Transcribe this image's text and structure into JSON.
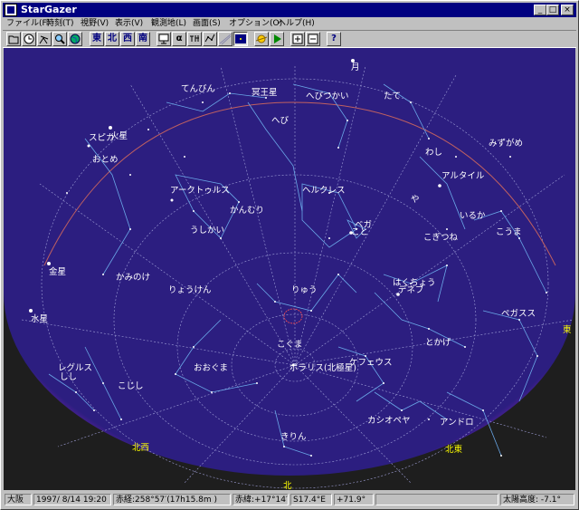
{
  "window": {
    "title": "StarGazer"
  },
  "menu": [
    {
      "label": "ファイル(F)"
    },
    {
      "label": "時刻(T)"
    },
    {
      "label": "視野(V)"
    },
    {
      "label": "表示(V)"
    },
    {
      "label": "観測地(L)"
    },
    {
      "label": "画面(S)"
    },
    {
      "label": "オプション(O)"
    },
    {
      "label": "ヘルプ(H)"
    }
  ],
  "toolbar": {
    "east_label": "東",
    "north_label": "北",
    "west_label": "西",
    "south_label": "南",
    "alpha_label": "α",
    "help_label": "?"
  },
  "colors": {
    "sky": "#2c1e80",
    "ground": "#1e1e1e",
    "horizon_glow": "#c828c8",
    "planet_label": "#ffff00"
  },
  "sky": {
    "constellations": [
      {
        "name": "てんびん"
      },
      {
        "name": "へびつかい"
      },
      {
        "name": "たて"
      },
      {
        "name": "へび"
      },
      {
        "name": "スピカ"
      },
      {
        "name": "わし"
      },
      {
        "name": "みずがめ"
      },
      {
        "name": "おとめ"
      },
      {
        "name": "アルタイル"
      },
      {
        "name": "アークトゥルス"
      },
      {
        "name": "ヘルクレス"
      },
      {
        "name": "や"
      },
      {
        "name": "いるか"
      },
      {
        "name": "かんむり"
      },
      {
        "name": "ベガ"
      },
      {
        "name": "こと"
      },
      {
        "name": "うしかい"
      },
      {
        "name": "こぎつね"
      },
      {
        "name": "こうま"
      },
      {
        "name": "かみのけ"
      },
      {
        "name": "りょうけん"
      },
      {
        "name": "りゅう"
      },
      {
        "name": "はくちょう"
      },
      {
        "name": "デネブ"
      },
      {
        "name": "ペガスス"
      },
      {
        "name": "こぐま"
      },
      {
        "name": "とかげ"
      },
      {
        "name": "おおぐま"
      },
      {
        "name": "ポラリス(北極星)"
      },
      {
        "name": "ケフェウス"
      },
      {
        "name": "こじし"
      },
      {
        "name": "レグルス"
      },
      {
        "name": "しし"
      },
      {
        "name": "カシオペヤ"
      },
      {
        "name": "アンドロ"
      },
      {
        "name": "きりん"
      }
    ],
    "planets": [
      {
        "name": "月"
      },
      {
        "name": "冥王星"
      },
      {
        "name": "火星"
      },
      {
        "name": "金星"
      },
      {
        "name": "水星"
      }
    ],
    "directions": [
      {
        "label": "東"
      },
      {
        "label": "北西"
      },
      {
        "label": "北東"
      },
      {
        "label": "北"
      }
    ]
  },
  "status": {
    "location": "大阪",
    "datetime": "1997/ 8/14 19:20",
    "ra": "赤経:258°57′(17h15.8m )",
    "dec": "赤緯:+17°14′",
    "azimuth": "S17.4°E",
    "altitude": "+71.9°",
    "sun_altitude": "太陽高度: -7.1°"
  }
}
